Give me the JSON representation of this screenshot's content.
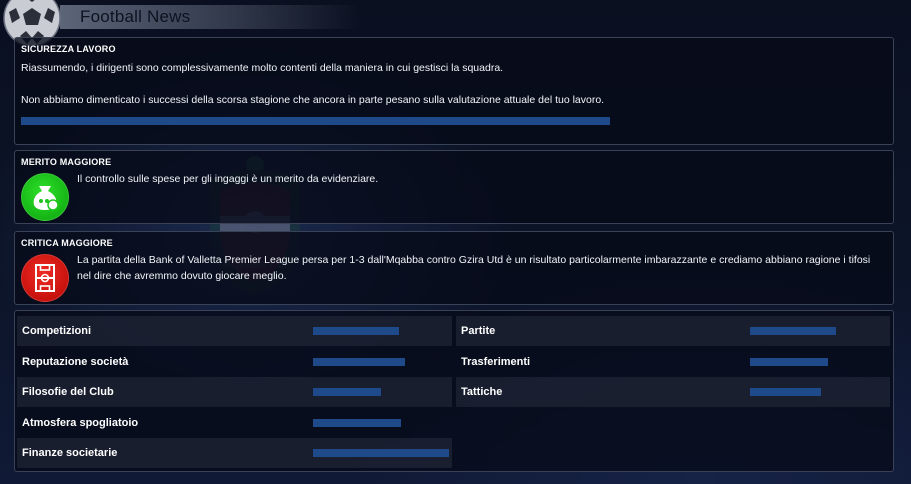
{
  "header": {
    "title": "Football News"
  },
  "security": {
    "title": "SICUREZZA LAVORO",
    "line1": "Riassumendo, i dirigenti sono complessivamente molto contenti della maniera in cui gestisci la squadra.",
    "line2": "Non abbiamo dimenticato i successi della scorsa stagione che ancora in parte pesano sulla valutazione attuale del tuo lavoro.",
    "bar_fraction": 1.0,
    "bar_color": "#1f4a8a"
  },
  "merit": {
    "title": "MERITO MAGGIORE",
    "text": "Il controllo sulle spese per gli ingaggi è un merito da evidenziare.",
    "icon": "money-bag-icon",
    "icon_color": "#1fc51c"
  },
  "critic": {
    "title": "CRITICA MAGGIORE",
    "text": "La partita della Bank of Valletta Premier League persa per 1-3 dall'Mqabba contro Gzira Utd è un risultato particolarmente imbarazzante e crediamo abbiano ragione i tifosi nel dire che avremmo dovuto giocare meglio.",
    "icon": "football-pitch-icon",
    "icon_color": "#d8150f"
  },
  "stats": {
    "left": [
      {
        "label": "Competizioni",
        "fraction": 0.63
      },
      {
        "label": "Reputazione società",
        "fraction": 0.68
      },
      {
        "label": "Filosofie del Club",
        "fraction": 0.5
      },
      {
        "label": "Atmosfera spogliatoio",
        "fraction": 0.65
      },
      {
        "label": "Finanze societarie",
        "fraction": 1.0
      }
    ],
    "right": [
      {
        "label": "Partite",
        "fraction": 0.63
      },
      {
        "label": "Trasferimenti",
        "fraction": 0.57
      },
      {
        "label": "Tattiche",
        "fraction": 0.52
      }
    ]
  }
}
